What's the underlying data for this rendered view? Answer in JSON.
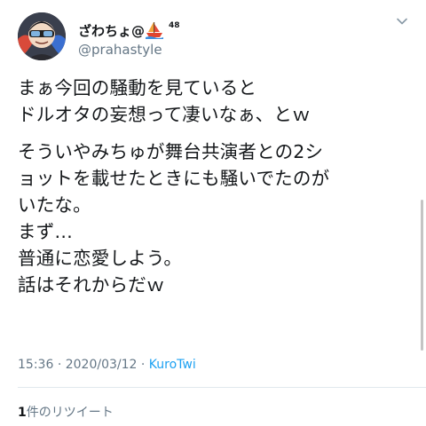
{
  "user": {
    "display_name": "ざわちょ@",
    "badge_number": "48",
    "handle": "@prahastyle",
    "avatar": "avatar-image",
    "badge_icon": "ship-icon"
  },
  "tweet": {
    "paragraphs": [
      [
        "まぁ今回の騒動を見ていると",
        "ドルオタの妄想って凄いなぁ、とｗ"
      ],
      [
        "そういやみちゅが舞台共演者との2シ",
        "ョットを載せたときにも騒いでたのが",
        "いたな。",
        "まず…",
        "普通に恋愛しよう。",
        "話はそれからだｗ"
      ]
    ],
    "time": "15:36",
    "date": "2020/03/12",
    "separator": "·",
    "source": "KuroTwi"
  },
  "stats": {
    "retweet_count": "1",
    "retweet_label": "件のリツイート"
  },
  "icons": {
    "menu": "chevron-down-icon"
  }
}
